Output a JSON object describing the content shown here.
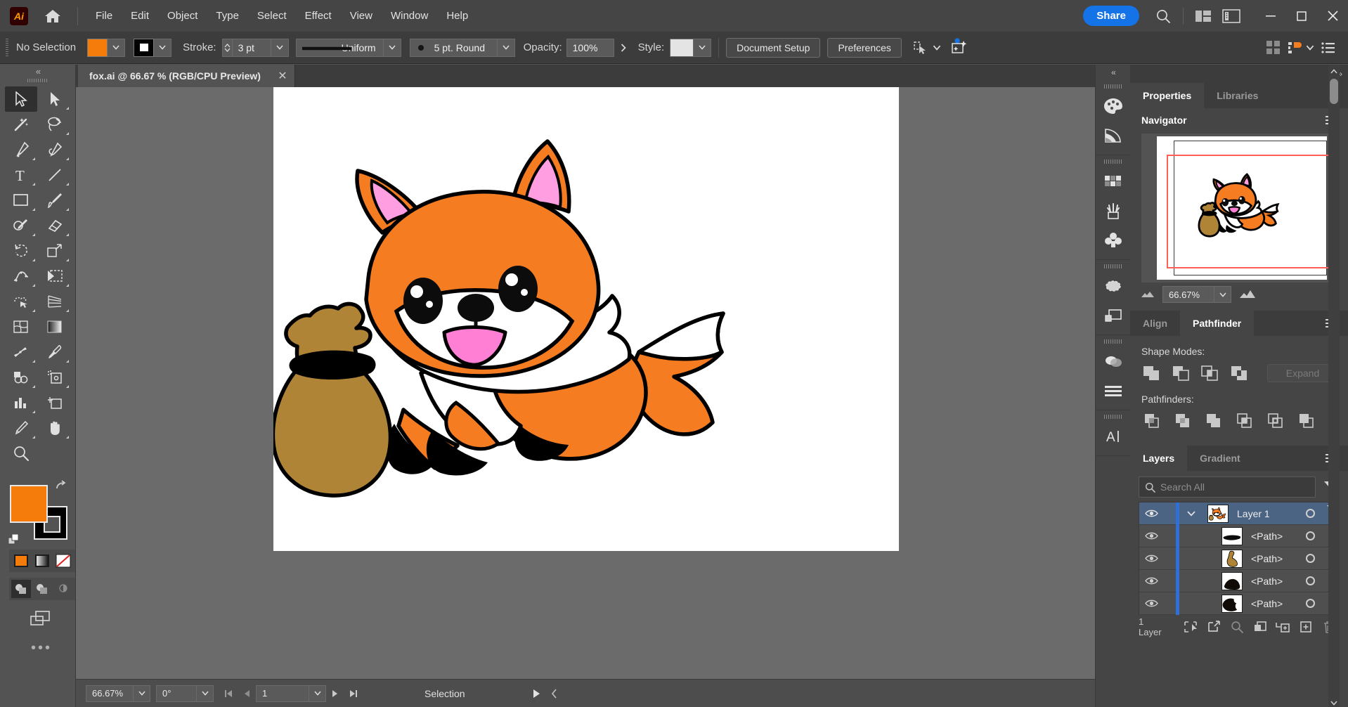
{
  "app": {
    "logo_text": "Ai",
    "menu": [
      "File",
      "Edit",
      "Object",
      "Type",
      "Select",
      "Effect",
      "View",
      "Window",
      "Help"
    ],
    "share_label": "Share"
  },
  "control_bar": {
    "selection_status": "No Selection",
    "fill_color": "#f57c0a",
    "stroke_color": "#000000",
    "stroke_label": "Stroke:",
    "stroke_weight": "3 pt",
    "stroke_profile": "Uniform",
    "brush_definition": "5 pt. Round",
    "opacity_label": "Opacity:",
    "opacity_value": "100%",
    "style_label": "Style:",
    "document_setup": "Document Setup",
    "preferences": "Preferences"
  },
  "toolbar": {
    "tools": [
      {
        "name": "selection-tool",
        "active": true
      },
      {
        "name": "direct-selection-tool",
        "active": false
      },
      {
        "name": "magic-wand-tool",
        "active": false
      },
      {
        "name": "lasso-tool",
        "active": false
      },
      {
        "name": "pen-tool",
        "active": false
      },
      {
        "name": "curvature-tool",
        "active": false
      },
      {
        "name": "type-tool",
        "active": false
      },
      {
        "name": "line-segment-tool",
        "active": false
      },
      {
        "name": "rectangle-tool",
        "active": false
      },
      {
        "name": "paintbrush-tool",
        "active": false
      },
      {
        "name": "shaper-tool",
        "active": false
      },
      {
        "name": "eraser-tool",
        "active": false
      },
      {
        "name": "rotate-tool",
        "active": false
      },
      {
        "name": "scale-tool",
        "active": false
      },
      {
        "name": "width-tool",
        "active": false
      },
      {
        "name": "free-transform-tool",
        "active": false
      },
      {
        "name": "shape-builder-tool",
        "active": false
      },
      {
        "name": "perspective-grid-tool",
        "active": false
      },
      {
        "name": "mesh-tool",
        "active": false
      },
      {
        "name": "gradient-tool",
        "active": false
      },
      {
        "name": "blend-tool",
        "active": false
      },
      {
        "name": "eyedropper-tool",
        "active": false
      },
      {
        "name": "symbol-sprayer-tool",
        "active": false
      },
      {
        "name": "column-graph-tool",
        "active": false
      },
      {
        "name": "artboard-tool",
        "active": false
      },
      {
        "name": "slice-tool",
        "active": false
      },
      {
        "name": "hand-tool",
        "active": false
      },
      {
        "name": "zoom-tool",
        "active": false
      }
    ]
  },
  "document": {
    "tab_title": "fox.ai @ 66.67 % (RGB/CPU Preview)"
  },
  "status_bar": {
    "zoom": "66.67%",
    "rotation": "0°",
    "artboard_number": "1",
    "tool_status": "Selection"
  },
  "panels": {
    "top_tabs": [
      {
        "label": "Properties",
        "active": true
      },
      {
        "label": "Libraries",
        "active": false
      }
    ],
    "navigator": {
      "title": "Navigator",
      "zoom": "66.67%"
    },
    "align_pathfinder": {
      "tabs": [
        {
          "label": "Align",
          "active": false
        },
        {
          "label": "Pathfinder",
          "active": true
        }
      ],
      "shape_modes_label": "Shape Modes:",
      "expand_label": "Expand",
      "pathfinders_label": "Pathfinders:",
      "shape_modes": [
        "unite",
        "minus-front",
        "intersect",
        "exclude"
      ],
      "pathfinders": [
        "divide",
        "trim",
        "merge",
        "crop",
        "outline",
        "minus-back"
      ]
    },
    "layers": {
      "tabs": [
        {
          "label": "Layers",
          "active": true
        },
        {
          "label": "Gradient",
          "active": false
        }
      ],
      "search_placeholder": "Search All",
      "rows": [
        {
          "name": "Layer 1",
          "selected": true,
          "is_layer": true,
          "thumb": "fox"
        },
        {
          "name": "<Path>",
          "selected": false,
          "is_layer": false,
          "thumb": "band"
        },
        {
          "name": "<Path>",
          "selected": false,
          "is_layer": false,
          "thumb": "sack"
        },
        {
          "name": "<Path>",
          "selected": false,
          "is_layer": false,
          "thumb": "blackshape"
        },
        {
          "name": "<Path>",
          "selected": false,
          "is_layer": false,
          "thumb": "blackshape2"
        }
      ],
      "footer_count": "1 Layer"
    }
  },
  "artwork": {
    "title": "fox-with-sack-illustration",
    "colors": {
      "fox_orange": "#f57c20",
      "fox_white": "#ffffff",
      "ear_pink": "#ff9ee0",
      "mouth_pink": "#ff7fd4",
      "outline": "#000000",
      "sack_tan": "#b08437",
      "sack_band": "#000000"
    }
  }
}
